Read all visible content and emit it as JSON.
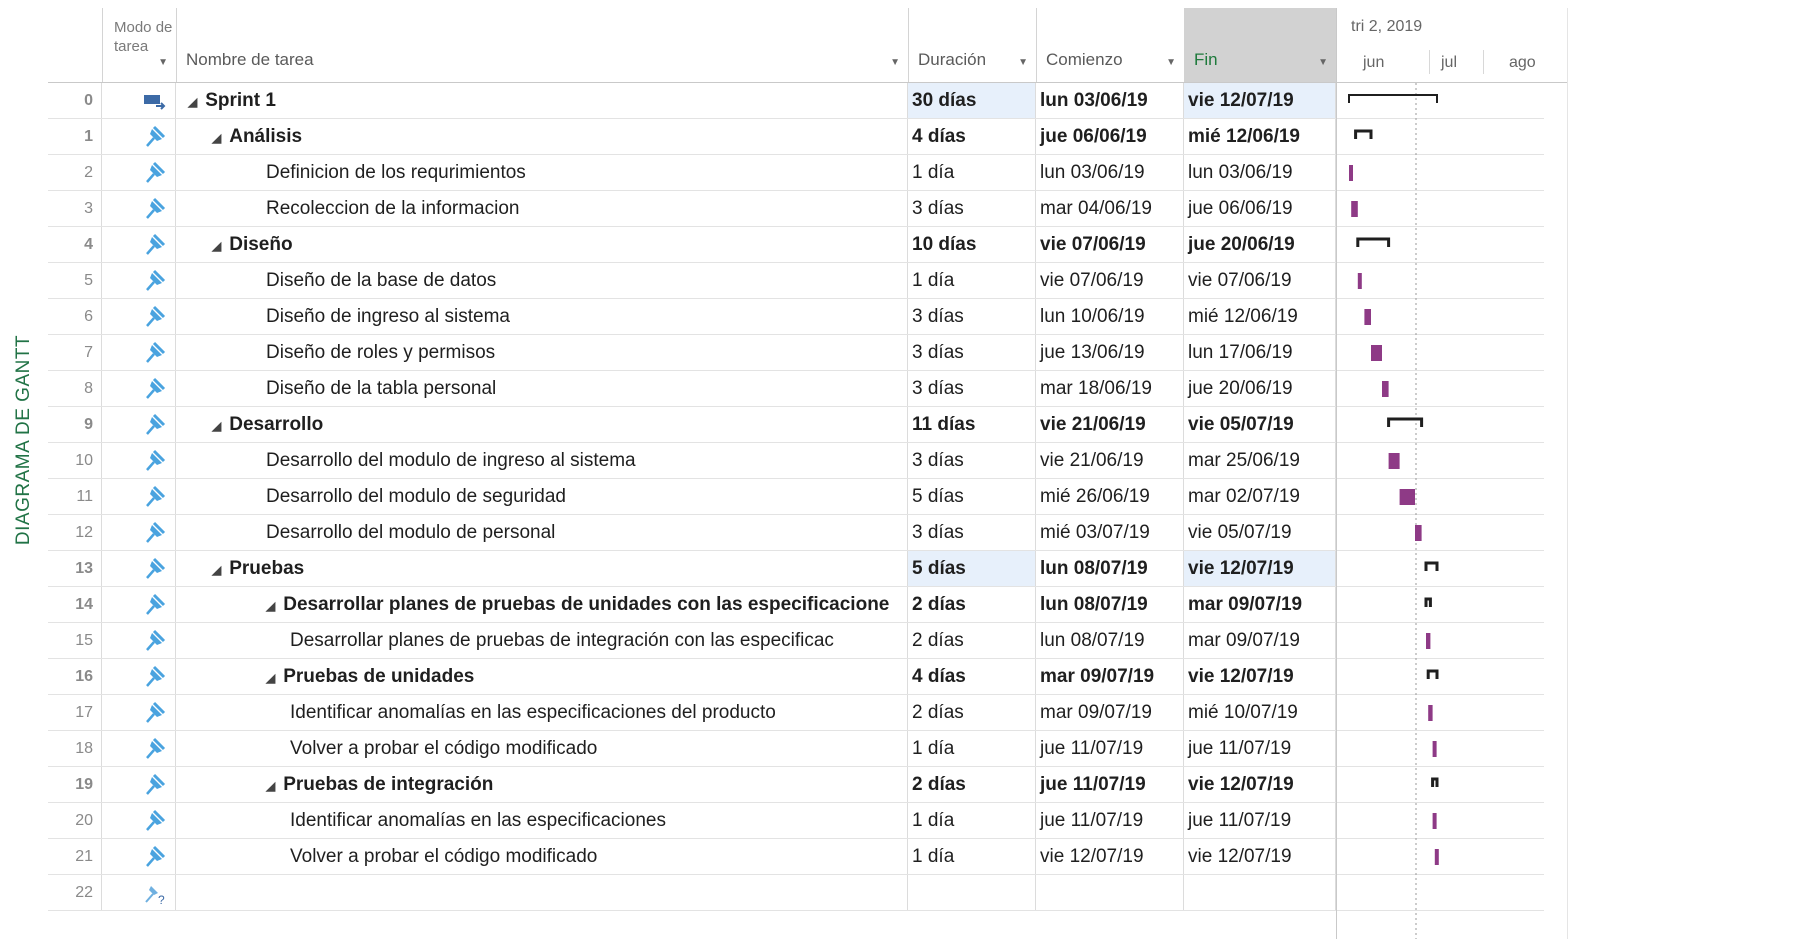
{
  "sidebar": {
    "label": "DIAGRAMA DE GANTT"
  },
  "columns": {
    "mode": "Modo de tarea",
    "name": "Nombre de tarea",
    "duration": "Duración",
    "start": "Comienzo",
    "end": "Fin"
  },
  "timescale": {
    "quarter": "tri 2, 2019",
    "months": [
      "jun",
      "jul",
      "ago"
    ]
  },
  "colors": {
    "bar": "#8e3a86",
    "bar_light": "#c78bbf",
    "summary": "#1f1f1f",
    "accent": "#217346",
    "highlight": "#e7f0fb"
  },
  "tasks": [
    {
      "id": "0",
      "name": "Sprint 1",
      "duration": "30 días",
      "start": "lun 03/06/19",
      "end": "vie 12/07/19",
      "level": 0,
      "summary": true
    },
    {
      "id": "1",
      "name": "Análisis",
      "duration": "4 días",
      "start": "jue 06/06/19",
      "end": "mié 12/06/19",
      "level": 1,
      "summary": true
    },
    {
      "id": "2",
      "name": "Definicion de los requrimientos",
      "duration": "1 día",
      "start": "lun 03/06/19",
      "end": "lun 03/06/19",
      "level": 2,
      "summary": false
    },
    {
      "id": "3",
      "name": "Recoleccion de la informacion",
      "duration": "3 días",
      "start": "mar 04/06/19",
      "end": "jue 06/06/19",
      "level": 2,
      "summary": false
    },
    {
      "id": "4",
      "name": "Diseño",
      "duration": "10 días",
      "start": "vie 07/06/19",
      "end": "jue 20/06/19",
      "level": 1,
      "summary": true
    },
    {
      "id": "5",
      "name": "Diseño de la base de datos",
      "duration": "1 día",
      "start": "vie 07/06/19",
      "end": "vie 07/06/19",
      "level": 2,
      "summary": false
    },
    {
      "id": "6",
      "name": "Diseño de ingreso al sistema",
      "duration": "3 días",
      "start": "lun 10/06/19",
      "end": "mié 12/06/19",
      "level": 2,
      "summary": false
    },
    {
      "id": "7",
      "name": "Diseño de roles y permisos",
      "duration": "3 días",
      "start": "jue 13/06/19",
      "end": "lun 17/06/19",
      "level": 2,
      "summary": false
    },
    {
      "id": "8",
      "name": "Diseño de la tabla personal",
      "duration": "3 días",
      "start": "mar 18/06/19",
      "end": "jue 20/06/19",
      "level": 2,
      "summary": false
    },
    {
      "id": "9",
      "name": "Desarrollo",
      "duration": "11 días",
      "start": "vie 21/06/19",
      "end": "vie 05/07/19",
      "level": 1,
      "summary": true
    },
    {
      "id": "10",
      "name": "Desarrollo del modulo de ingreso al sistema",
      "duration": "3 días",
      "start": "vie 21/06/19",
      "end": "mar 25/06/19",
      "level": 2,
      "summary": false
    },
    {
      "id": "11",
      "name": "Desarrollo del modulo de seguridad",
      "duration": "5 días",
      "start": "mié 26/06/19",
      "end": "mar 02/07/19",
      "level": 2,
      "summary": false
    },
    {
      "id": "12",
      "name": "Desarrollo del modulo de personal",
      "duration": "3 días",
      "start": "mié 03/07/19",
      "end": "vie 05/07/19",
      "level": 2,
      "summary": false
    },
    {
      "id": "13",
      "name": "Pruebas",
      "duration": "5 días",
      "start": "lun 08/07/19",
      "end": "vie 12/07/19",
      "level": 1,
      "summary": true
    },
    {
      "id": "14",
      "name": "Desarrollar planes de pruebas de unidades con las especificacione",
      "duration": "2 días",
      "start": "lun 08/07/19",
      "end": "mar 09/07/19",
      "level": 2,
      "summary": true
    },
    {
      "id": "15",
      "name": "Desarrollar planes de pruebas de integración con las especificac",
      "duration": "2 días",
      "start": "lun 08/07/19",
      "end": "mar 09/07/19",
      "level": 3,
      "summary": false
    },
    {
      "id": "16",
      "name": "Pruebas de unidades",
      "duration": "4 días",
      "start": "mar 09/07/19",
      "end": "vie 12/07/19",
      "level": 2,
      "summary": true
    },
    {
      "id": "17",
      "name": "Identificar anomalías en las especificaciones del producto",
      "duration": "2 días",
      "start": "mar 09/07/19",
      "end": "mié 10/07/19",
      "level": 3,
      "summary": false
    },
    {
      "id": "18",
      "name": "Volver a probar el código modificado",
      "duration": "1 día",
      "start": "jue 11/07/19",
      "end": "jue 11/07/19",
      "level": 3,
      "summary": false
    },
    {
      "id": "19",
      "name": "Pruebas de integración",
      "duration": "2 días",
      "start": "jue 11/07/19",
      "end": "vie 12/07/19",
      "level": 2,
      "summary": true
    },
    {
      "id": "20",
      "name": "Identificar anomalías en las especificaciones",
      "duration": "1 día",
      "start": "jue 11/07/19",
      "end": "jue 11/07/19",
      "level": 3,
      "summary": false
    },
    {
      "id": "21",
      "name": "Volver a probar el código modificado",
      "duration": "1 día",
      "start": "vie 12/07/19",
      "end": "vie 12/07/19",
      "level": 3,
      "summary": false
    },
    {
      "id": "22",
      "name": "",
      "duration": "",
      "start": "",
      "end": "",
      "level": 0,
      "summary": false
    }
  ]
}
